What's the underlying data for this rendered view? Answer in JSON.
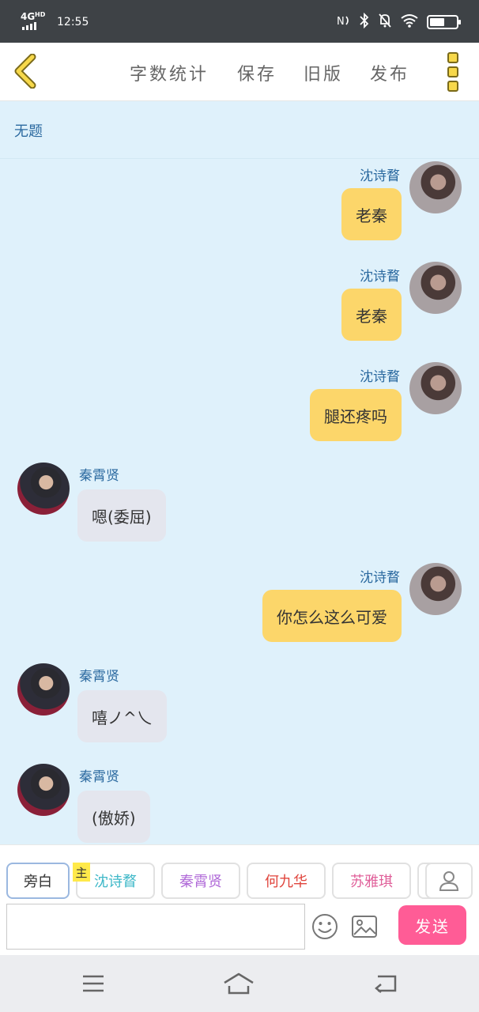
{
  "status_bar": {
    "network": "4G",
    "network_sup": "HD",
    "time": "12:55",
    "battery_level": 0.55,
    "icons": [
      "nfc-icon",
      "bluetooth-icon",
      "mute-bell-icon",
      "wifi-icon",
      "battery-icon"
    ]
  },
  "toolbar": {
    "back_icon": "chevron-left-icon",
    "word_count": "字数统计",
    "save": "保存",
    "old_version": "旧版",
    "publish": "发布",
    "more_icon": "more-menu-icon"
  },
  "chat": {
    "title": "无题",
    "messages": [
      {
        "side": "right",
        "name": "沈诗瞀",
        "text": "老秦"
      },
      {
        "side": "right",
        "name": "沈诗瞀",
        "text": "老秦"
      },
      {
        "side": "right",
        "name": "沈诗瞀",
        "text": "腿还疼吗"
      },
      {
        "side": "left",
        "name": "秦霄贤",
        "text": "嗯(委屈)"
      },
      {
        "side": "right",
        "name": "沈诗瞀",
        "text": "你怎么这么可爱"
      },
      {
        "side": "left",
        "name": "秦霄贤",
        "text": "嘻ノ^乀"
      },
      {
        "side": "left",
        "name": "秦霄贤",
        "text": "(傲娇)"
      }
    ]
  },
  "input_area": {
    "roles": [
      "旁白",
      "沈诗瞀",
      "秦霄贤",
      "何九华",
      "苏雅琪"
    ],
    "role_colors": [
      "#333333",
      "#3fb8c8",
      "#b06ad8",
      "#e0443c",
      "#e0609a"
    ],
    "active_role_index": 0,
    "main_badge": "主",
    "placeholder": "",
    "send_label": "发送",
    "send_color": "#ff5c96"
  },
  "navbar": {
    "icons": [
      "menu-icon",
      "home-icon",
      "back-icon"
    ]
  }
}
